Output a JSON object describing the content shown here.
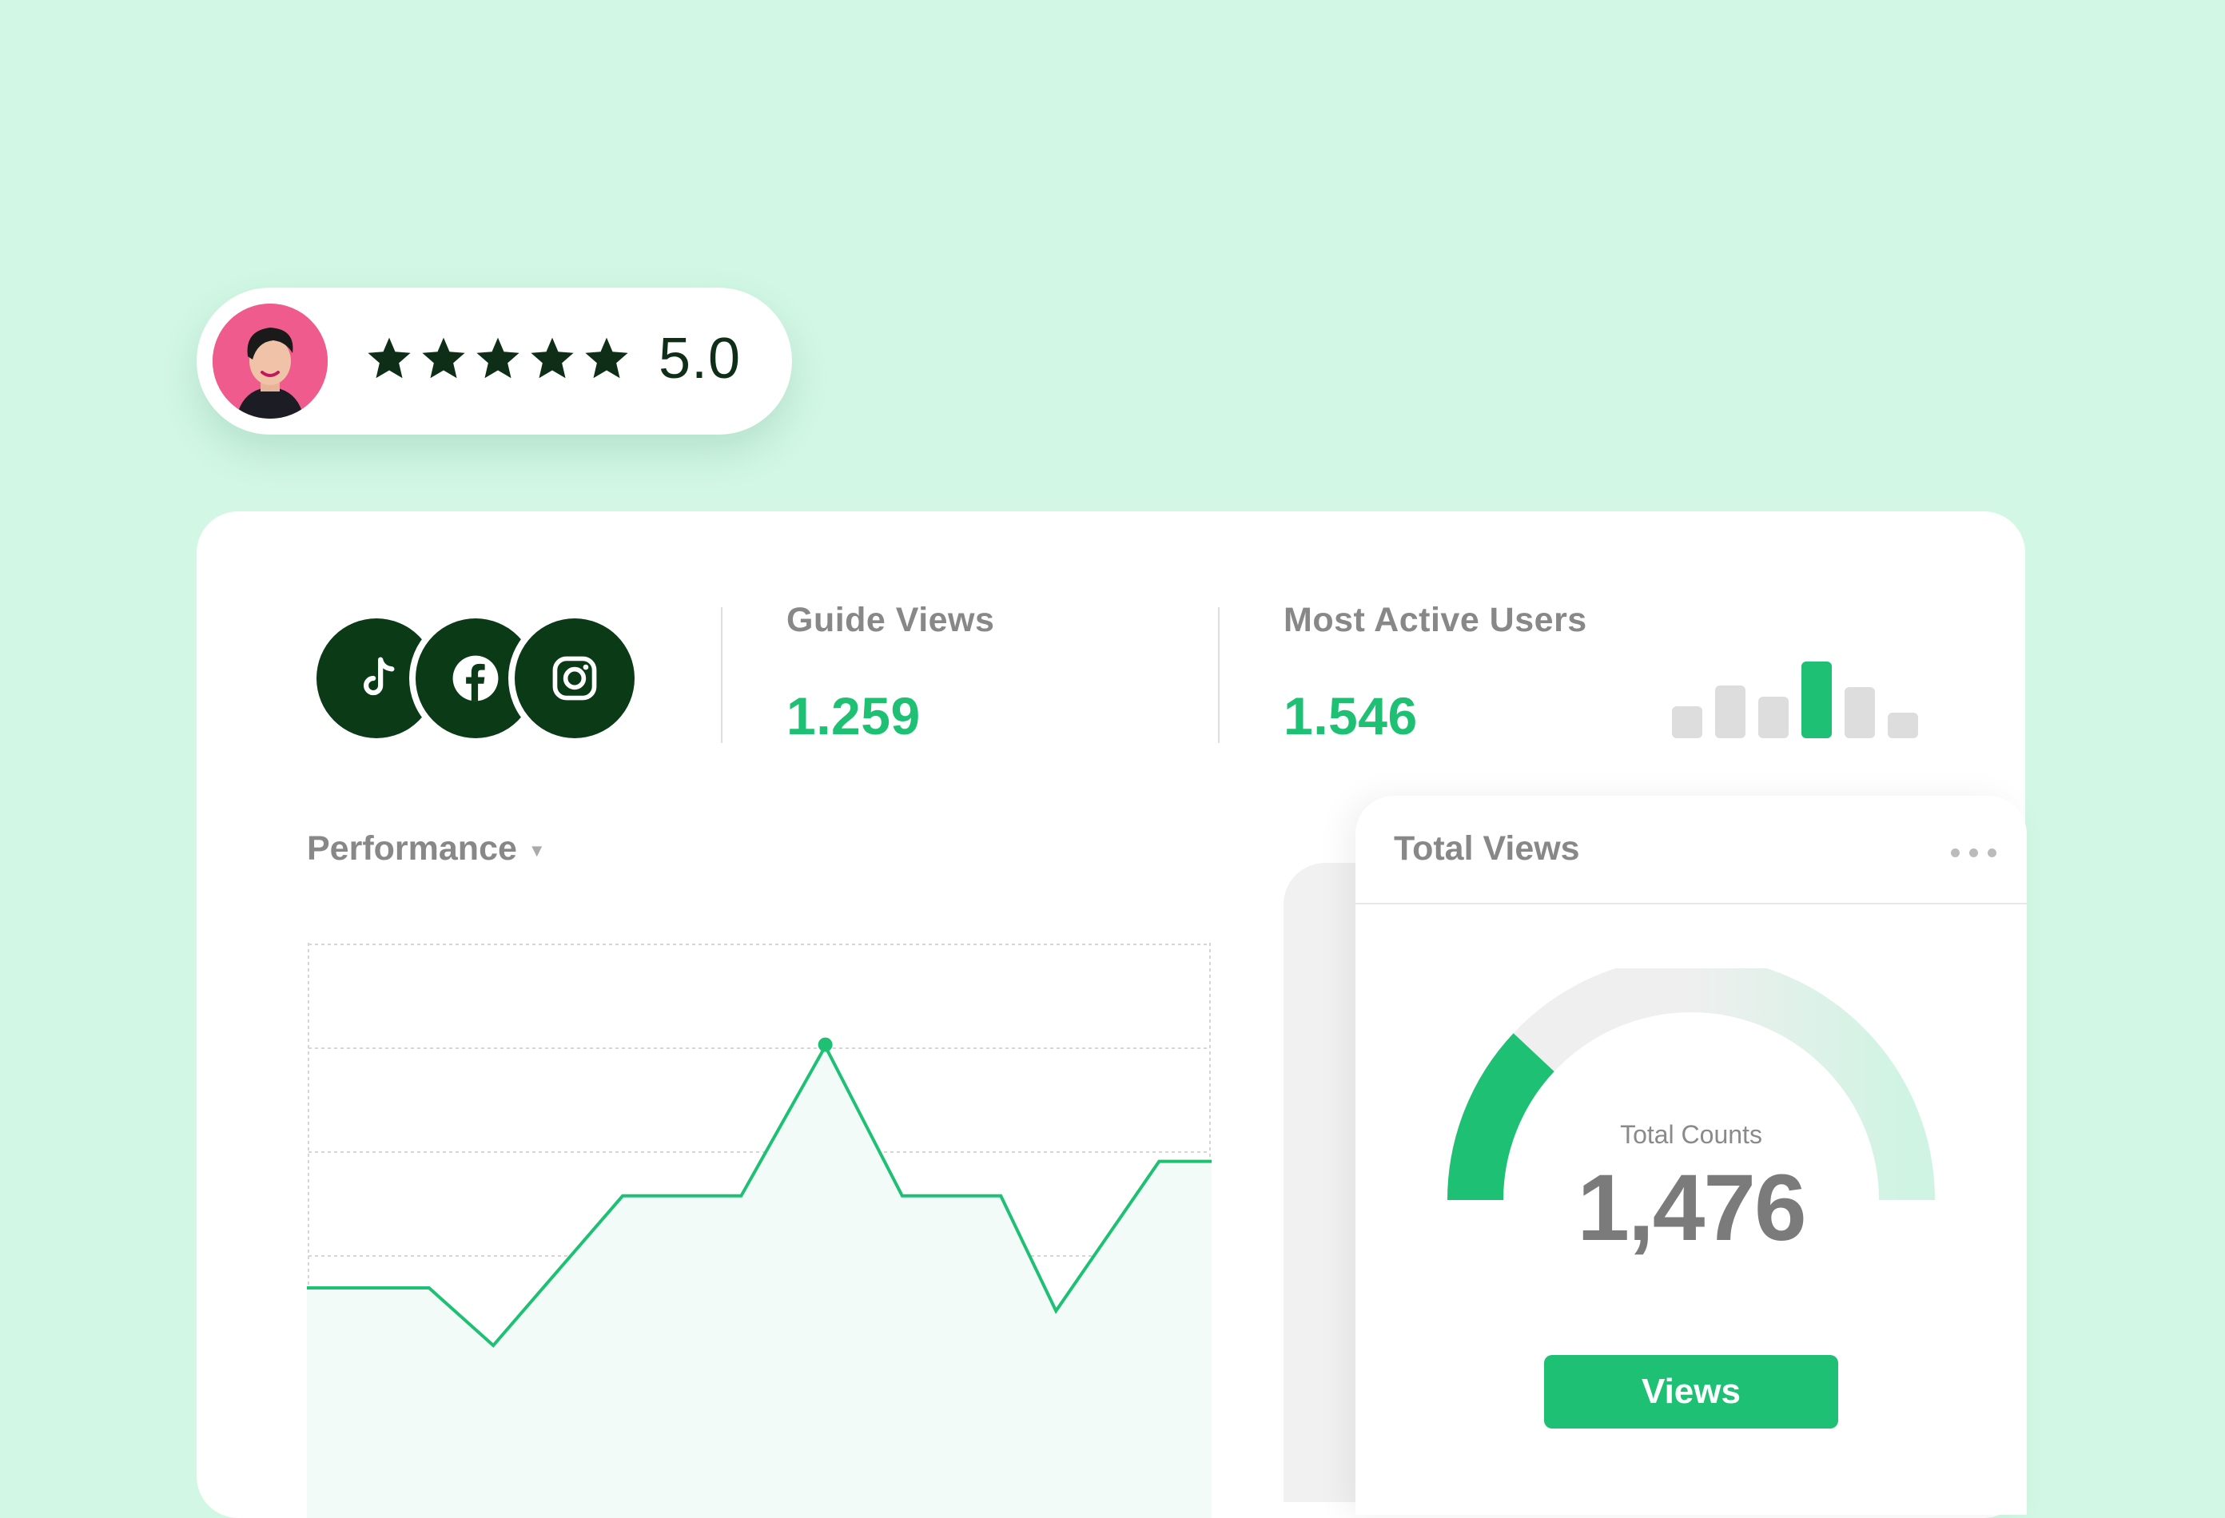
{
  "rating": {
    "value": "5.0",
    "stars": 5,
    "star_color": "#0e2e17"
  },
  "social_icons": [
    "tiktok-icon",
    "facebook-icon",
    "instagram-icon"
  ],
  "stats": [
    {
      "label": "Guide Views",
      "value": "1.259"
    },
    {
      "label": "Most Active Users",
      "value": "1.546"
    }
  ],
  "active_users_bars": {
    "values": [
      2,
      3.3,
      2.6,
      4.8,
      3.2,
      1.6
    ],
    "highlight_index": 3
  },
  "performance": {
    "label": "Performance"
  },
  "chart_data": {
    "type": "area",
    "x": [
      0,
      1,
      2,
      3,
      4,
      5,
      6,
      7,
      8,
      9,
      10,
      11
    ],
    "values": [
      2.0,
      2.0,
      1.5,
      2.8,
      2.8,
      4.1,
      2.8,
      2.8,
      1.8,
      3.1,
      3.1
    ],
    "highlight_point_index": 5,
    "ylim": [
      0,
      5
    ],
    "grid": true,
    "line_color": "#1ec174"
  },
  "total_views": {
    "title": "Total Views",
    "gauge_label": "Total Counts",
    "gauge_value": "1,476",
    "gauge_fraction": 0.24,
    "button_label": "Views"
  },
  "colors": {
    "background": "#d2f7e5",
    "accent": "#1ec174",
    "dark": "#0b3a17"
  }
}
